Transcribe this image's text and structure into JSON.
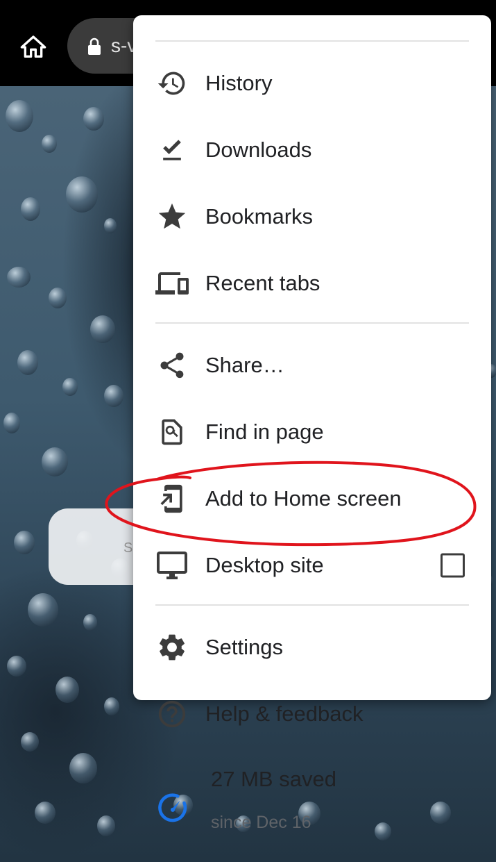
{
  "topbar": {
    "url_fragment": "s-v",
    "home_icon": "home-icon",
    "lock_icon": "lock-icon"
  },
  "page": {
    "search_hint": "S"
  },
  "menu": {
    "items": [
      {
        "label": "History",
        "icon": "history-icon"
      },
      {
        "label": "Downloads",
        "icon": "download-done-icon"
      },
      {
        "label": "Bookmarks",
        "icon": "star-icon"
      },
      {
        "label": "Recent tabs",
        "icon": "devices-icon"
      },
      {
        "label": "Share…",
        "icon": "share-icon"
      },
      {
        "label": "Find in page",
        "icon": "find-in-page-icon"
      },
      {
        "label": "Add to Home screen",
        "icon": "add-to-home-screen-icon"
      },
      {
        "label": "Desktop site",
        "icon": "desktop-icon",
        "checked": false
      },
      {
        "label": "Settings",
        "icon": "gear-icon"
      },
      {
        "label": "Help & feedback",
        "icon": "help-icon"
      }
    ],
    "data_saver": {
      "title": "27 MB saved",
      "subtitle": "since Dec 16",
      "icon": "speedometer-icon"
    }
  },
  "annotation": {
    "shape": "hand-drawn ellipse",
    "color": "#e0141c",
    "target": "Add to Home screen"
  },
  "colors": {
    "menu_background": "#ffffff",
    "menu_text": "#202124",
    "icon_gray": "#3c3c3c",
    "data_saver_blue": "#1a73e8",
    "topbar": "#000000"
  }
}
